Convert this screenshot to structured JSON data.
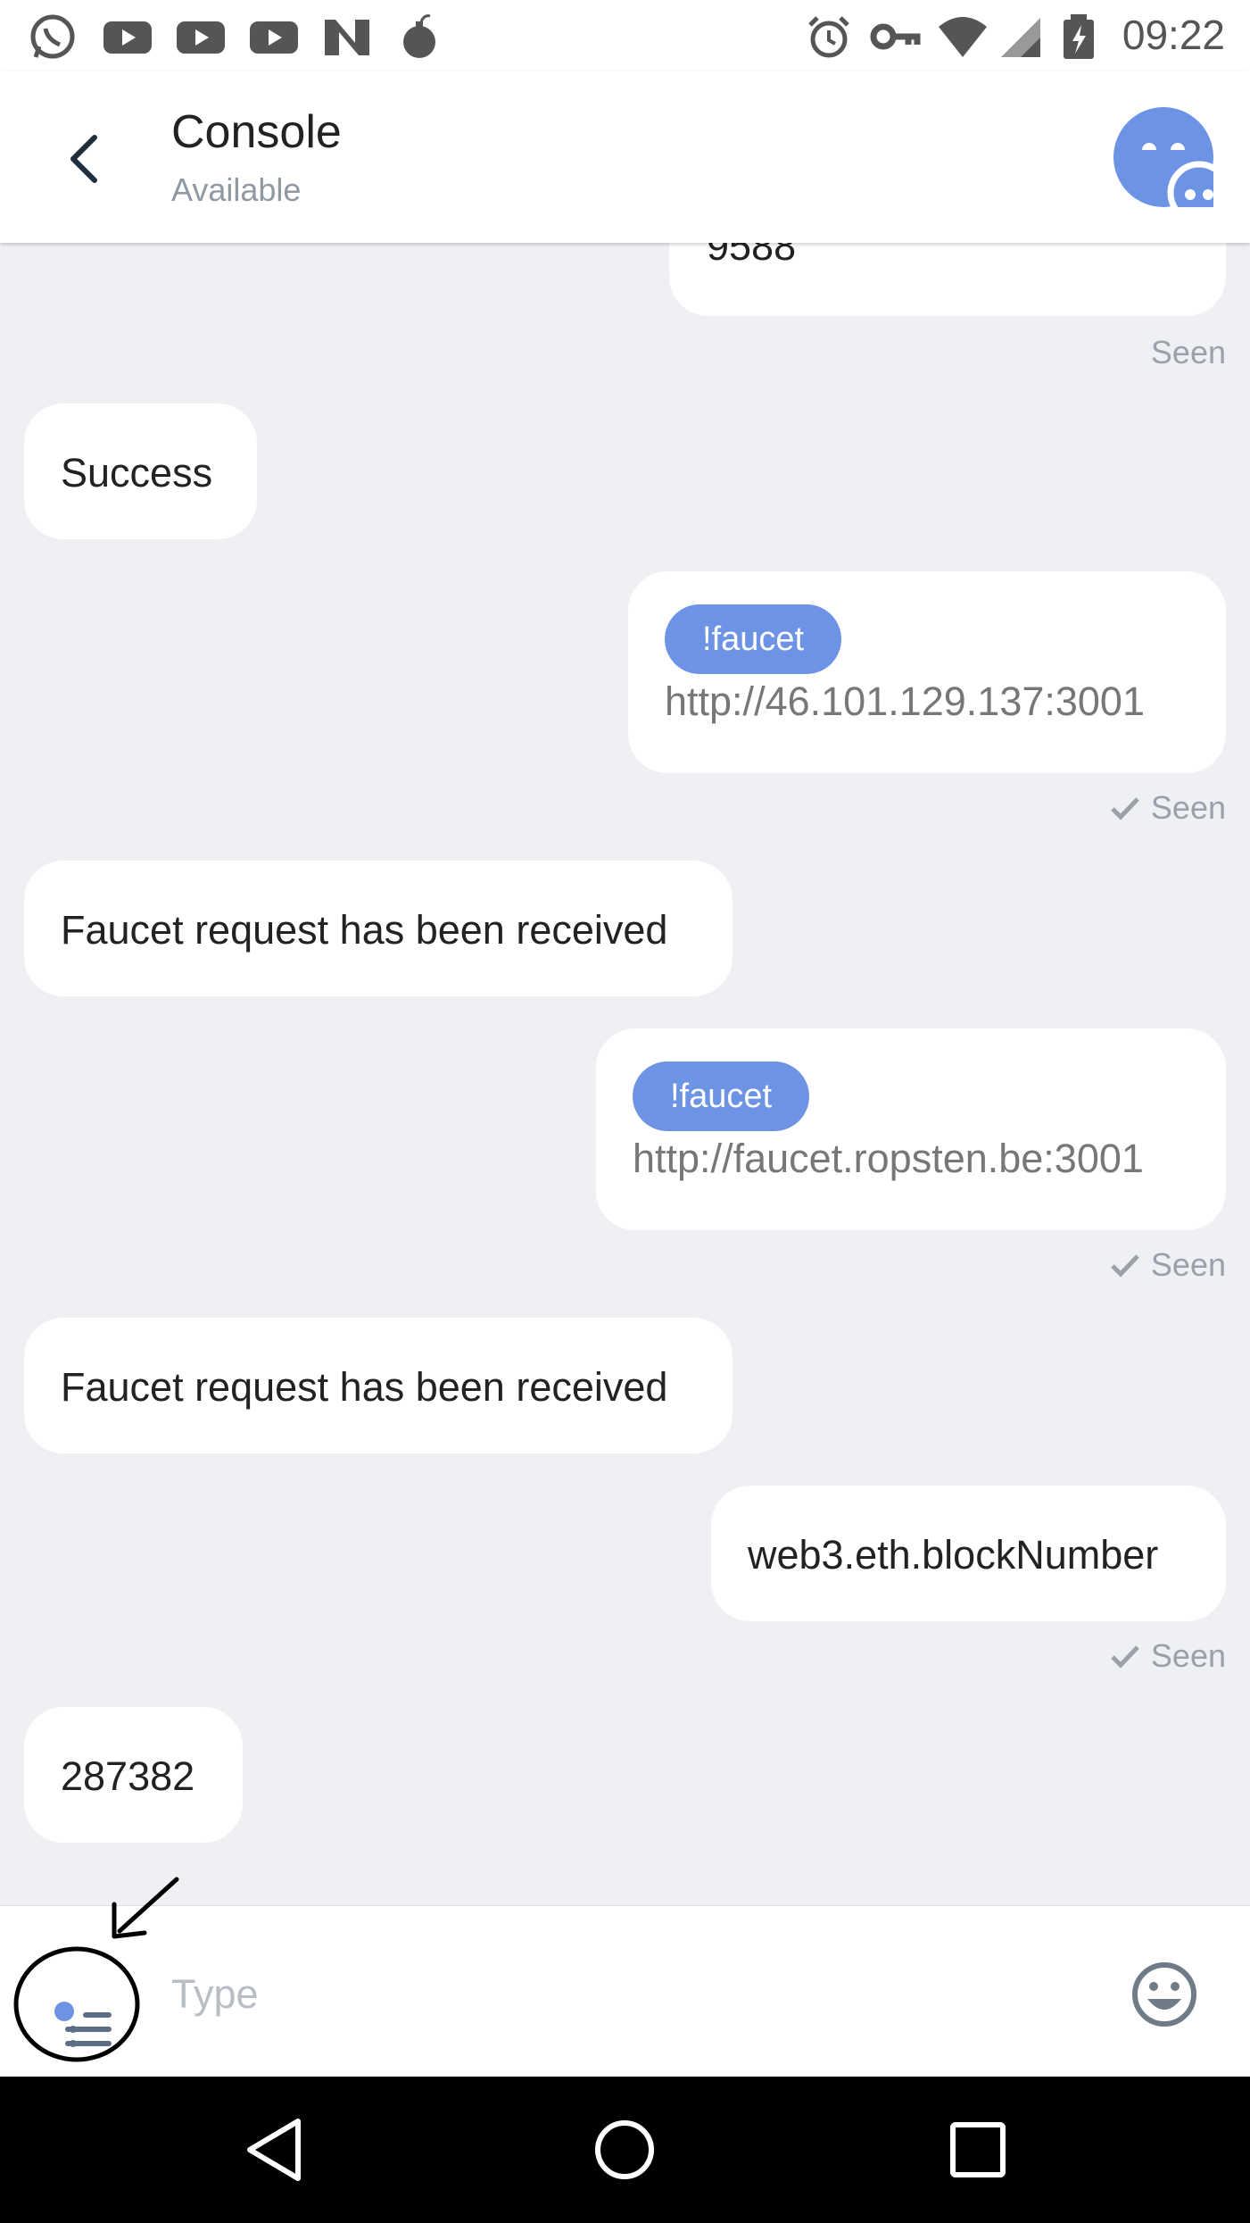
{
  "status_bar": {
    "time": "09:22",
    "left_icons": [
      "whatsapp-icon",
      "youtube-icon",
      "youtube-icon",
      "youtube-icon",
      "n-app-icon",
      "bomb-icon"
    ],
    "right_icons": [
      "alarm-icon",
      "vpn-key-icon",
      "wifi-icon",
      "signal-icon",
      "battery-charging-icon"
    ]
  },
  "header": {
    "title": "Console",
    "subtitle": "Available",
    "avatar_color": "#6d93e4"
  },
  "messages": [
    {
      "side": "out",
      "text": "9588",
      "status": "Seen",
      "checked": false
    },
    {
      "side": "in",
      "text": "Success"
    },
    {
      "side": "out",
      "command": "!faucet",
      "arg": "http://46.101.129.137:3001",
      "status": "Seen",
      "checked": true
    },
    {
      "side": "in",
      "text": "Faucet request has been received"
    },
    {
      "side": "out",
      "command": "!faucet",
      "arg": "http://faucet.ropsten.be:3001",
      "status": "Seen",
      "checked": true
    },
    {
      "side": "in",
      "text": "Faucet request has been received"
    },
    {
      "side": "out",
      "text": "web3.eth.blockNumber",
      "status": "Seen",
      "checked": true
    },
    {
      "side": "in",
      "text": "287382"
    }
  ],
  "input": {
    "placeholder": "Type",
    "value": ""
  },
  "colors": {
    "accent": "#6d93e4",
    "chat_background": "#eef0f3",
    "seen_text": "#9aa1aa"
  }
}
